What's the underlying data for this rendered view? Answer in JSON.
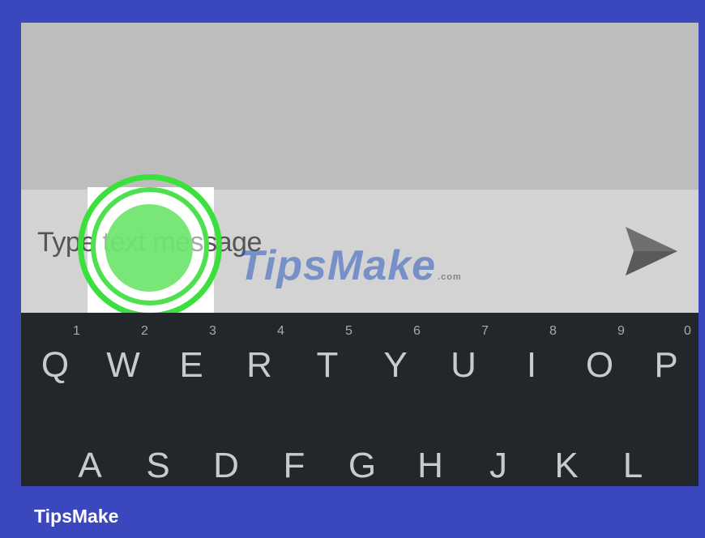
{
  "message_input": {
    "placeholder": "Type text message"
  },
  "send_button": {
    "icon": "send-icon"
  },
  "watermark": {
    "text": "TipsMake",
    "suffix": ".com"
  },
  "keyboard": {
    "row1": [
      {
        "label": "Q",
        "hint": "1"
      },
      {
        "label": "W",
        "hint": "2"
      },
      {
        "label": "E",
        "hint": "3"
      },
      {
        "label": "R",
        "hint": "4"
      },
      {
        "label": "T",
        "hint": "5"
      },
      {
        "label": "Y",
        "hint": "6"
      },
      {
        "label": "U",
        "hint": "7"
      },
      {
        "label": "I",
        "hint": "8"
      },
      {
        "label": "O",
        "hint": "9"
      },
      {
        "label": "P",
        "hint": "0"
      }
    ],
    "row2": [
      {
        "label": "A"
      },
      {
        "label": "S"
      },
      {
        "label": "D"
      },
      {
        "label": "F"
      },
      {
        "label": "G"
      },
      {
        "label": "H"
      },
      {
        "label": "J"
      },
      {
        "label": "K"
      },
      {
        "label": "L"
      }
    ]
  },
  "footer": {
    "brand": "TipsMake"
  },
  "colors": {
    "frame": "#3a47bd",
    "keyboard": "#22272b",
    "tap_highlight": "#3ce03c"
  }
}
